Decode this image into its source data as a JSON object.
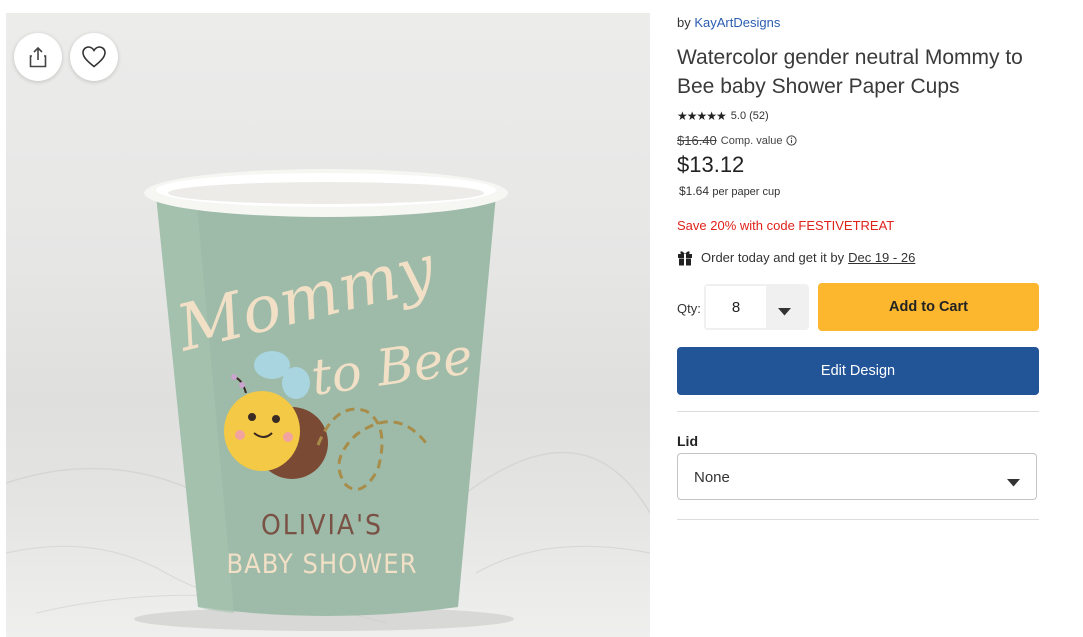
{
  "image": {
    "alt_text_lines": [
      "Mommy",
      "to Bee"
    ],
    "cup_name": "OLIVIA'S",
    "cup_event": "BABY SHOWER",
    "share_icon": "share-icon",
    "favorite_icon": "heart-icon"
  },
  "product": {
    "by_prefix": "by",
    "seller": "KayArtDesigns",
    "title": "Watercolor gender neutral Mommy to Bee baby Shower Paper Cups",
    "stars": "★★★★★",
    "rating": "5.0",
    "review_count": "(52)",
    "compare_price": "$16.40",
    "compare_label": "Comp. value",
    "price": "$13.12",
    "unit_price": "$1.64",
    "unit_label": "per paper cup",
    "promo": "Save 20% with code FESTIVETREAT",
    "delivery_prefix": "Order today and get it by",
    "delivery_dates": "Dec 19 - 26"
  },
  "purchase": {
    "qty_label": "Qty:",
    "qty_value": "8",
    "add_to_cart": "Add to Cart",
    "edit_design": "Edit Design"
  },
  "options": {
    "lid_label": "Lid",
    "lid_value": "None"
  },
  "colors": {
    "cup": "#9dbba8",
    "cart_button": "#fcb72f",
    "edit_button": "#225498",
    "promo": "#e0221b",
    "seller_link": "#2a5db0"
  }
}
